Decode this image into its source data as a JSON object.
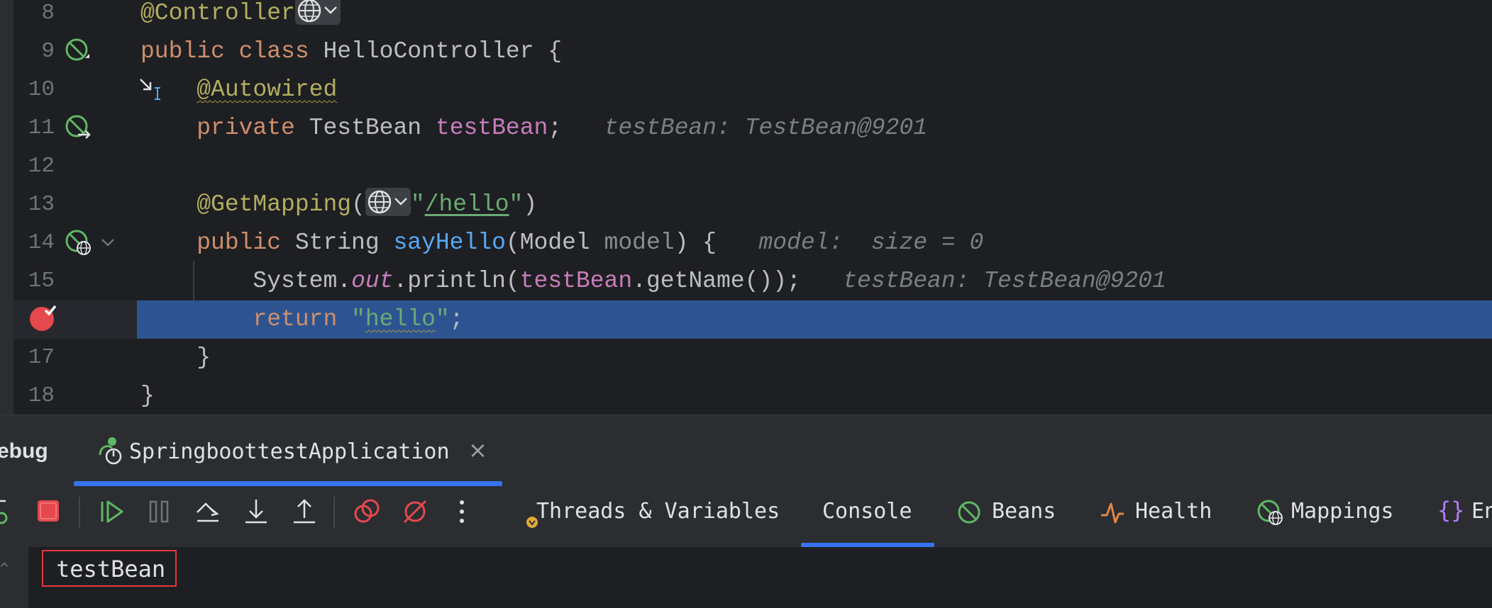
{
  "editor": {
    "lines": [
      {
        "num": "8",
        "parts": [
          {
            "t": "@Controller",
            "c": "ann"
          }
        ]
      },
      {
        "num": "9",
        "parts": [
          {
            "t": "public ",
            "c": "kw"
          },
          {
            "t": "class ",
            "c": "kw"
          },
          {
            "t": "HelloController {",
            "c": ""
          }
        ]
      },
      {
        "num": "10",
        "parts": [
          {
            "t": "    ",
            "c": ""
          },
          {
            "t": "@Autowired",
            "c": "ann wavy"
          }
        ]
      },
      {
        "num": "11",
        "parts": [
          {
            "t": "    ",
            "c": ""
          },
          {
            "t": "private ",
            "c": "kw"
          },
          {
            "t": "TestBean ",
            "c": ""
          },
          {
            "t": "testBean",
            "c": "field"
          },
          {
            "t": ";",
            "c": ""
          }
        ],
        "hint": "testBean: TestBean@9201"
      },
      {
        "num": "12",
        "parts": []
      },
      {
        "num": "13",
        "parts": [
          {
            "t": "    ",
            "c": ""
          },
          {
            "t": "@GetMapping",
            "c": "ann"
          },
          {
            "t": "(",
            "c": ""
          },
          {
            "t": "GLOBE",
            "c": "globe"
          },
          {
            "t": "\"",
            "c": "str"
          },
          {
            "t": "/hello",
            "c": "str underline"
          },
          {
            "t": "\"",
            "c": "str"
          },
          {
            "t": ")",
            "c": ""
          }
        ]
      },
      {
        "num": "14",
        "parts": [
          {
            "t": "    ",
            "c": ""
          },
          {
            "t": "public ",
            "c": "kw"
          },
          {
            "t": "String ",
            "c": ""
          },
          {
            "t": "sayHello",
            "c": "fn"
          },
          {
            "t": "(Model ",
            "c": ""
          },
          {
            "t": "model",
            "c": "param"
          },
          {
            "t": ") {",
            "c": ""
          }
        ],
        "hint": "model:  size = 0"
      },
      {
        "num": "15",
        "parts": [
          {
            "t": "        System.",
            "c": ""
          },
          {
            "t": "out",
            "c": "static"
          },
          {
            "t": ".println(",
            "c": ""
          },
          {
            "t": "testBean",
            "c": "field"
          },
          {
            "t": ".getName());",
            "c": ""
          }
        ],
        "hint": "testBean: TestBean@9201"
      },
      {
        "num": "",
        "parts": [
          {
            "t": "        ",
            "c": ""
          },
          {
            "t": "return ",
            "c": "kw"
          },
          {
            "t": "\"",
            "c": "str"
          },
          {
            "t": "hello",
            "c": "str wavy"
          },
          {
            "t": "\"",
            "c": "str"
          },
          {
            "t": ";",
            "c": ""
          }
        ]
      },
      {
        "num": "17",
        "parts": [
          {
            "t": "    }",
            "c": ""
          }
        ]
      },
      {
        "num": "18",
        "parts": [
          {
            "t": "}",
            "c": ""
          }
        ]
      }
    ]
  },
  "panel": {
    "debug_label": "ebug",
    "session_tab": "SpringboottestApplication",
    "close_glyph": "×",
    "view_tabs": [
      {
        "label": "Threads & Variables",
        "icon": "threads-variables-icon"
      },
      {
        "label": "Console",
        "icon": ""
      },
      {
        "label": "Beans",
        "icon": "beans-icon"
      },
      {
        "label": "Health",
        "icon": "health-icon"
      },
      {
        "label": "Mappings",
        "icon": "mappings-icon"
      },
      {
        "label": "En",
        "icon": "environment-icon"
      }
    ],
    "console_output": "testBean",
    "selected_tab": "Console"
  },
  "colors": {
    "accent": "#3574f0",
    "execution_line": "#2d5491",
    "breakpoint": "#e5484d",
    "spring_green": "#5fb865",
    "highlight_box": "#e5383b"
  }
}
